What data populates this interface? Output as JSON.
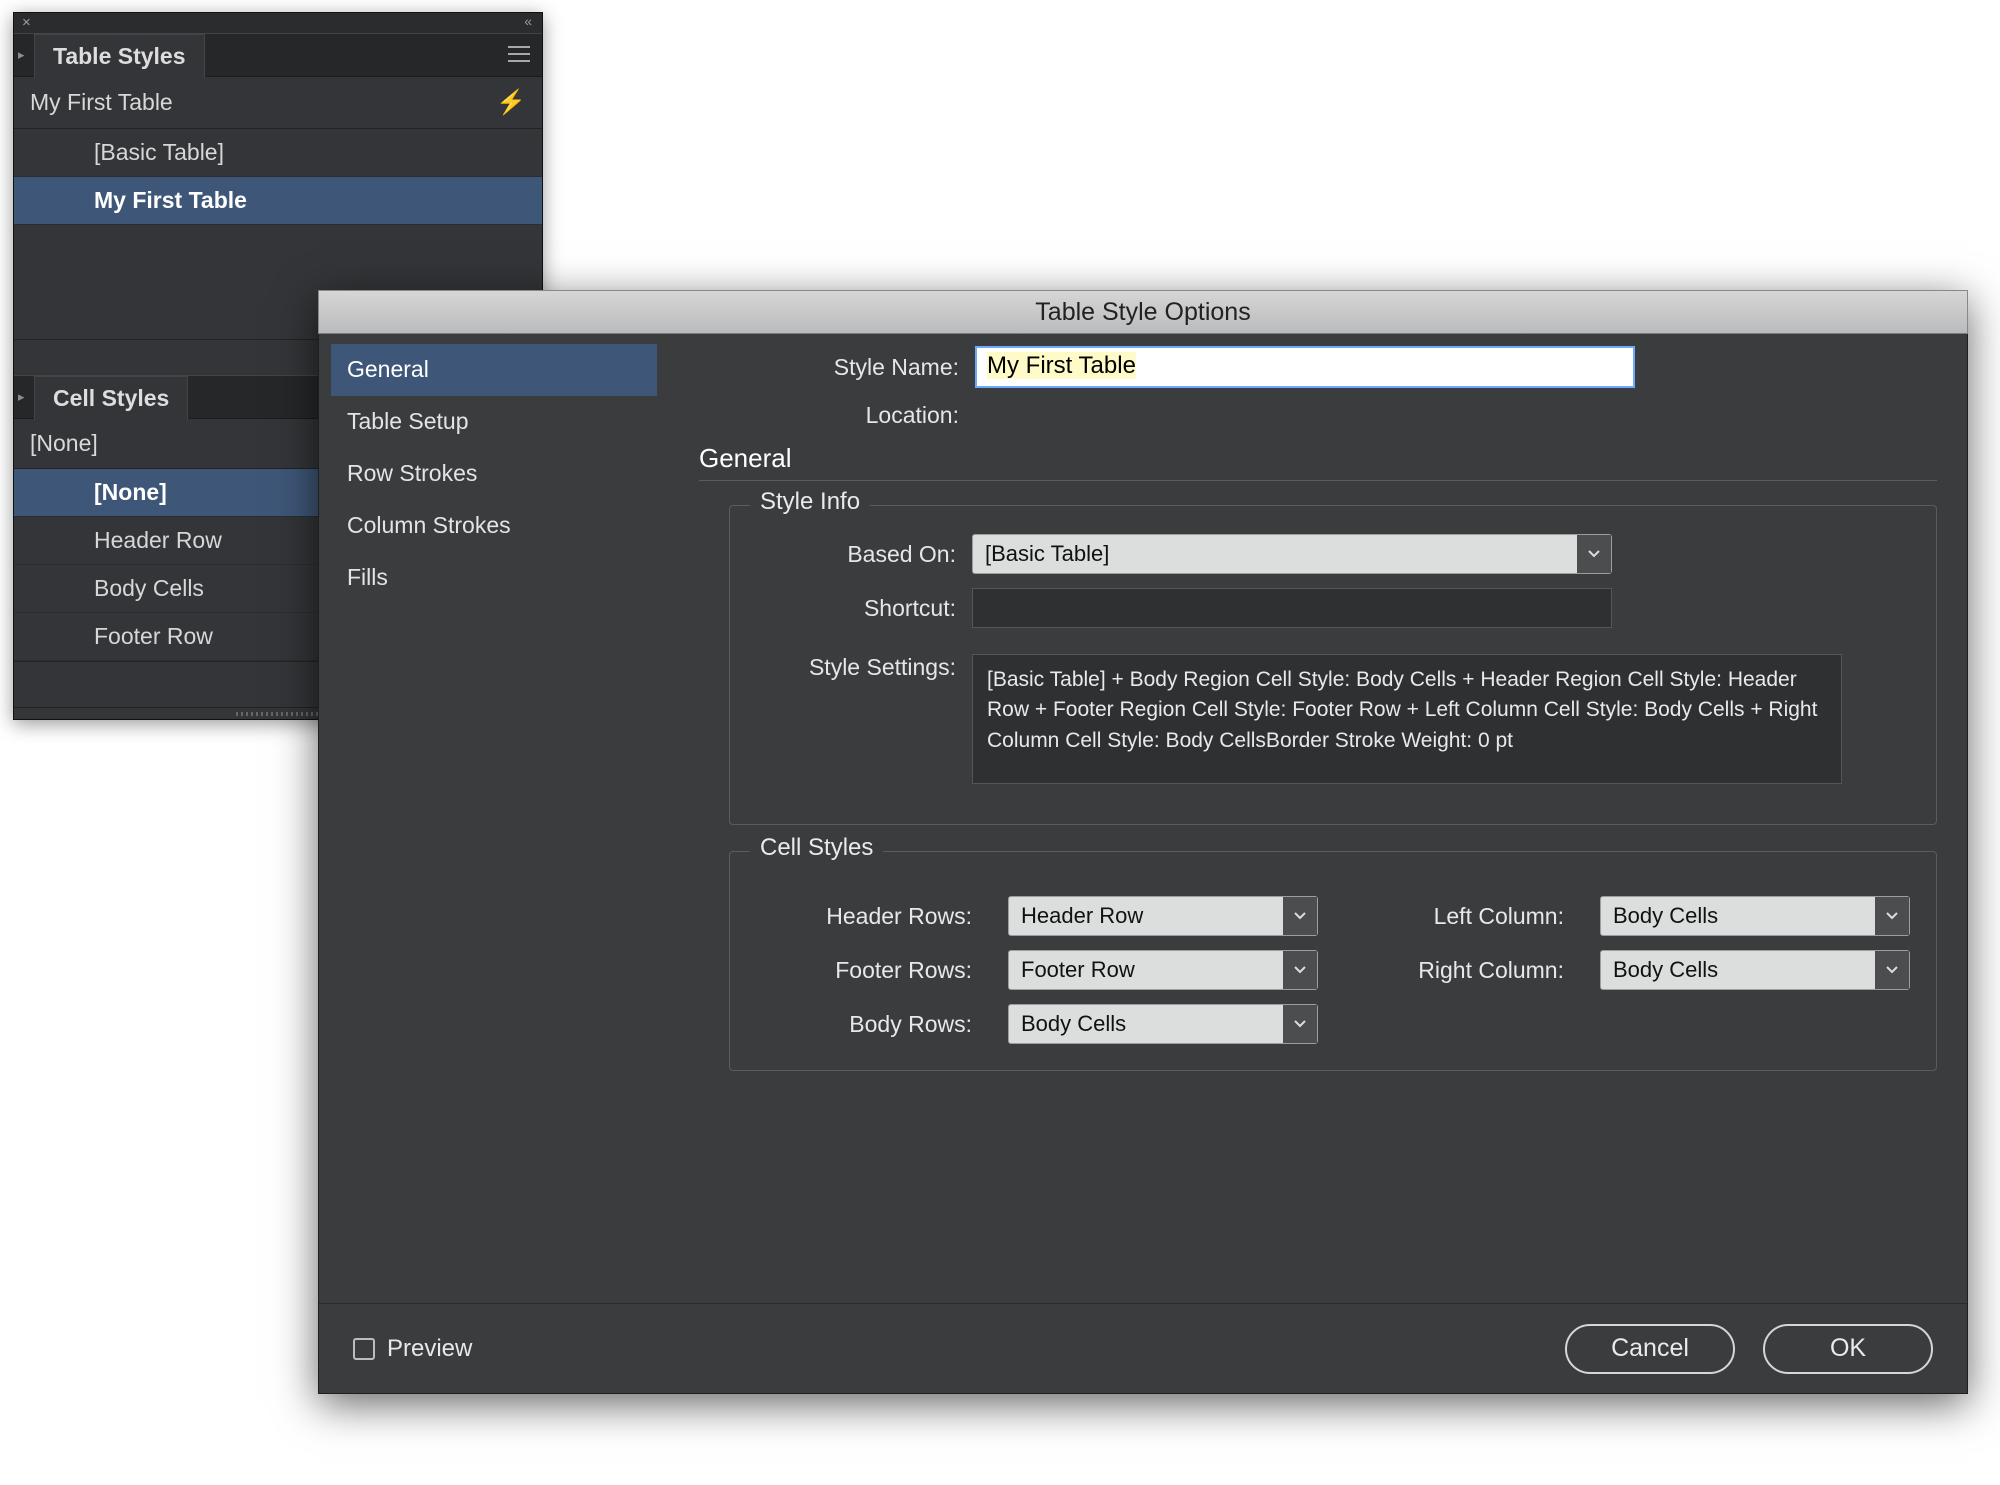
{
  "panel": {
    "tableStyles": {
      "tab": "Table Styles",
      "current": "My First Table",
      "items": [
        "[Basic Table]",
        "My First Table"
      ],
      "selectedIndex": 1
    },
    "cellStyles": {
      "tab": "Cell Styles",
      "current": "[None]",
      "items": [
        "[None]",
        "Header Row",
        "Body Cells",
        "Footer Row"
      ],
      "selectedIndex": 0
    }
  },
  "dialog": {
    "title": "Table Style Options",
    "sidenav": [
      "General",
      "Table Setup",
      "Row Strokes",
      "Column Strokes",
      "Fills"
    ],
    "styleNameLabel": "Style Name:",
    "styleName": "My First Table",
    "locationLabel": "Location:",
    "section": "General",
    "styleInfo": {
      "legend": "Style Info",
      "basedOnLabel": "Based On:",
      "basedOn": "[Basic Table]",
      "shortcutLabel": "Shortcut:",
      "settingsLabel": "Style Settings:",
      "settings": "[Basic Table] + Body Region Cell Style: Body Cells + Header Region Cell Style: Header Row + Footer Region Cell Style: Footer Row + Left Column Cell Style: Body Cells + Right Column Cell Style: Body CellsBorder Stroke Weight: 0 pt"
    },
    "cellStyles": {
      "legend": "Cell Styles",
      "headerRowsLabel": "Header Rows:",
      "headerRows": "Header Row",
      "footerRowsLabel": "Footer Rows:",
      "footerRows": "Footer Row",
      "bodyRowsLabel": "Body Rows:",
      "bodyRows": "Body Cells",
      "leftColumnLabel": "Left Column:",
      "leftColumn": "Body Cells",
      "rightColumnLabel": "Right Column:",
      "rightColumn": "Body Cells"
    },
    "preview": "Preview",
    "cancel": "Cancel",
    "ok": "OK"
  }
}
